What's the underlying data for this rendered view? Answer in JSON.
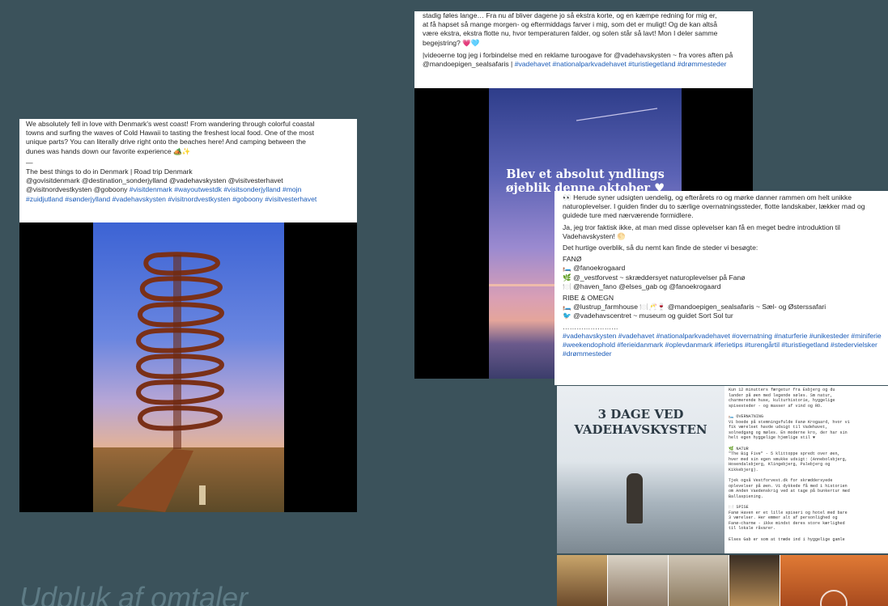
{
  "posts": [
    {
      "lines": [
        "We absolutely fell in love with Denmark's west coast! From wandering through colorful coastal",
        "towns and surfing the waves of Cold Hawaii to tasting the freshest local food. One of the most",
        "unique parts? You can literally drive right onto the beaches here! And camping between the",
        "dunes was hands down our favorite experience 🏕️✨",
        "—",
        "The best things to do in Denmark | Road trip Denmark",
        "@govisitdenmark @destination_sonderjylland @vadehavskysten @visitvesterhavet",
        "@visitnordvestkysten @goboony"
      ],
      "tags_inline": " #visitdenmark #wayoutwestdk #visitsonderjylland #mojn",
      "tags": "#zuidjutland #sønderjylland #vadehavskysten #visitnordvestkysten #goboony #visitvesterhavet"
    },
    {
      "lines": [
        "stadig føles lange… Fra nu af bliver dagene jo så ekstra korte, og  en kæmpe redning for mig er,",
        "at få hapset så mange morgen- og eftermiddags farver i mig, som det er muligt! Og de kan altså",
        "være ekstra, ekstra flotte nu, hvor temperaturen falder, og solen står så lavt! Mon I deler samme",
        "begejstring? 💗🩵"
      ],
      "para2": "|videoerne tog jeg i forbindelse med en reklame turoogave for @vadehavskysten ~ fra vores aften på @mandoepigen_sealsafaris |",
      "tags": "#vadehavet #nationalparkvadehavet #turistiegetland #drømmesteder",
      "overlay_line1": "Blev et absolut yndlings",
      "overlay_line2": "øjeblik denne oktober ♥"
    },
    {
      "p1": "👀 Herude syner udsigten uendelig, og  efterårets ro og mørke danner rammen om helt unikke naturoplevelser. I guiden finder du  to særlige overnatningssteder, flotte landskaber, lækker mad og guidede ture med nærværende formidlere.",
      "p2": "Ja, jeg tror faktisk ikke, at man med disse oplevelser kan få en meget bedre introduktion til Vadehavskysten! 🌕",
      "p3": "Det hurtige overblik, så du nemt kan finde de steder vi besøgte:",
      "h1": "FANØ",
      "l1": "🛏️ @fanoekrogaard",
      "l2": "🌿 @_vestforvest ~ skræddersyet naturoplevelser på Fanø",
      "l3": "🍽️ @haven_fano @elses_gab og @fanoekrogaard",
      "h2": "RIBE & OMEGN",
      "l4": "🛏️ @lustrup_farmhouse 🍽️🥂🍷 @mandoepigen_sealsafaris ~ Sæl- og Østerssafari",
      "l5": "🐦 @vadehavscentret ~ museum og guidet Sort Sol tur",
      "dots": "……………………",
      "tags": "#vadehavskysten #vadehavet #nationalparkvadehavet #overnatning #naturferie #unikesteder #miniferie #weekendophold #ferieidanmark #oplevdanmark #ferietips #turengårtil #turistiegetland #stedervielsker #drømmesteder"
    },
    {
      "title_line1": "3 DAGE VED",
      "title_line2": "VADEHAVSKYSTEN",
      "side_text": "Kun 12 minutters færgetur fra Esbjerg og du\nlander på øen med legende søles. Sm natur,\ncharmerende huse, kulturhistorie, hyggelige\nspisesteder - og masser af vind og RO.\n\n🛏️ OVERNATNING\nVi boede på stemningsfulde Fanø Krogaard, hvor vi\nfik værelset havde udsigt til Vadehavet,\nsolnedgang og møles. En moderne kro, der har sin\nhelt egen hyggelige hjemlige stil ♥\n\n🌿 NATUR\n\"The Big Five\" - 5 klittoppe spredt over øen,\nhver med sin egen smukke udsigt: (Annebolsbjerg,\nHosendalsbjerg, Klingebjerg, Palebjerg og\nKikkebjerg).\n\nTjek også Vestforvest.dk for skræddersyede\noplevelser på øen. Vi dykkede få med i historien\nom Anden Vaedenskrig ved at tage på bunkertur med\nBallaspiening.\n\n🍽️ SPISE\nFanø Haven er et lille spiseri og hotel med bare\n3 værelser. Her emmer alt af personlighed og\nFanø-charme - ikke mindst deres store kærlighed\ntil lokale råvarer.\n\nElses Gab er som at træde ind i hyggelige gamle"
    }
  ],
  "caption": "Udpluk af omtaler"
}
